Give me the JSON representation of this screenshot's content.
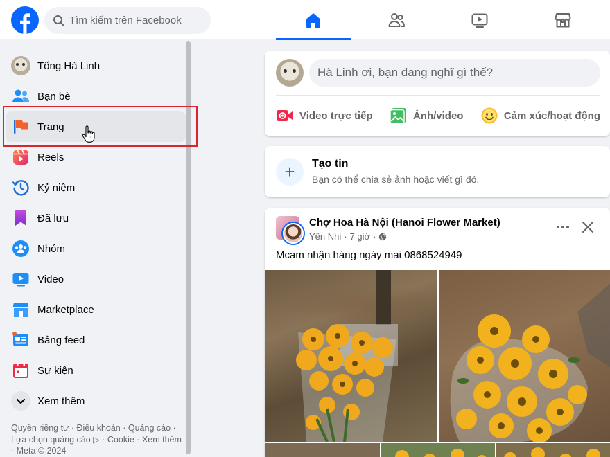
{
  "search": {
    "placeholder": "Tìm kiếm trên Facebook"
  },
  "nav": {
    "tabs": [
      "home-icon",
      "friends-icon",
      "video-icon",
      "marketplace-icon"
    ],
    "active_tab": 0
  },
  "sidebar": {
    "items": [
      {
        "label": "Tống Hà Linh",
        "icon": "profile-avatar"
      },
      {
        "label": "Bạn bè",
        "icon": "friends-icon"
      },
      {
        "label": "Trang",
        "icon": "flag-icon"
      },
      {
        "label": "Reels",
        "icon": "reels-icon"
      },
      {
        "label": "Kỷ niệm",
        "icon": "memories-icon"
      },
      {
        "label": "Đã lưu",
        "icon": "saved-icon"
      },
      {
        "label": "Nhóm",
        "icon": "groups-icon"
      },
      {
        "label": "Video",
        "icon": "video-icon"
      },
      {
        "label": "Marketplace",
        "icon": "marketplace-icon"
      },
      {
        "label": "Bảng feed",
        "icon": "feeds-icon"
      },
      {
        "label": "Sự kiện",
        "icon": "events-icon"
      },
      {
        "label": "Xem thêm",
        "icon": "chevron-down-icon"
      }
    ],
    "footer": "Quyền riêng tư · Điều khoản · Quảng cáo · Lựa chọn quảng cáo ▷ · Cookie · Xem thêm · Meta © 2024"
  },
  "composer": {
    "prompt": "Hà Linh ơi, bạn đang nghĩ gì thế?",
    "actions": [
      "Video trực tiếp",
      "Ảnh/video",
      "Cảm xúc/hoạt động"
    ]
  },
  "story": {
    "title": "Tạo tin",
    "subtitle": "Bạn có thể chia sẻ ảnh hoặc viết gì đó."
  },
  "post": {
    "page_name": "Chợ Hoa Hà Nội (Hanoi Flower Market)",
    "author": "Yến Nhi",
    "time": "7 giờ",
    "separator": "·",
    "caption": "Mcam nhận hàng ngày mai 0868524949"
  },
  "colors": {
    "brand": "#0866ff",
    "highlight": "#d9252e"
  }
}
